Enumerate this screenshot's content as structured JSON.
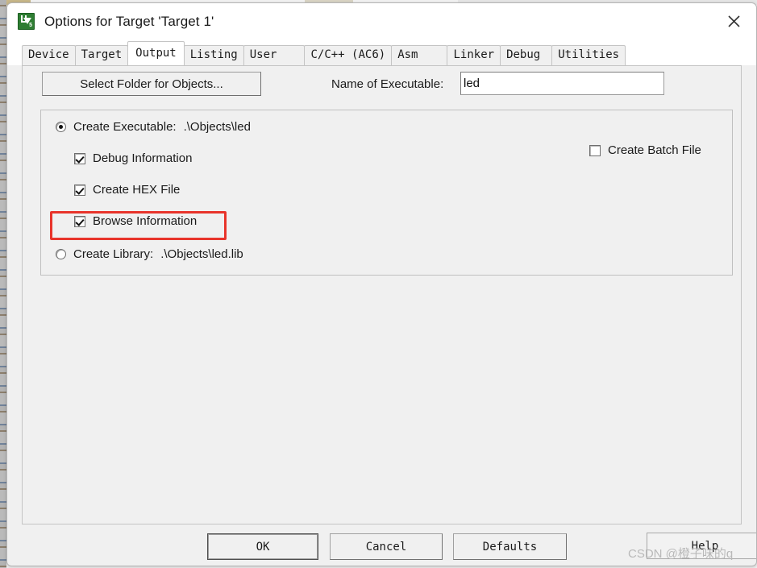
{
  "window": {
    "title": "Options for Target 'Target 1'",
    "icon": "uvision-logo-icon",
    "close_label": "✕"
  },
  "tabs": [
    {
      "label": "Device",
      "selected": false
    },
    {
      "label": "Target",
      "selected": false
    },
    {
      "label": "Output",
      "selected": true
    },
    {
      "label": "Listing",
      "selected": false
    },
    {
      "label": "User",
      "selected": false
    },
    {
      "label": "C/C++ (AC6)",
      "selected": false
    },
    {
      "label": "Asm",
      "selected": false
    },
    {
      "label": "Linker",
      "selected": false
    },
    {
      "label": "Debug",
      "selected": false
    },
    {
      "label": "Utilities",
      "selected": false
    }
  ],
  "output_tab": {
    "select_folder_button": "Select Folder for Objects...",
    "executable_name_label": "Name of Executable:",
    "executable_name_value": "led",
    "executable_name_placeholder": "",
    "create_executable": {
      "label": "Create Executable:",
      "path": ".\\Objects\\led",
      "selected": true
    },
    "debug_information": {
      "label": "Debug Information",
      "checked": true
    },
    "create_hex_file": {
      "label": "Create HEX File",
      "checked": true,
      "highlighted": true
    },
    "browse_information": {
      "label": "Browse Information",
      "checked": true
    },
    "create_library": {
      "label": "Create Library:",
      "path": ".\\Objects\\led.lib",
      "selected": false
    },
    "create_batch_file": {
      "label": "Create Batch File",
      "checked": false
    }
  },
  "footer": {
    "ok": "OK",
    "cancel": "Cancel",
    "defaults": "Defaults",
    "help": "Help"
  },
  "watermark": "CSDN @橙子味的q",
  "colors": {
    "highlight_red": "#e8342b",
    "dialog_face": "#f0f0f0",
    "title_bar": "#ffffff",
    "icon_green": "#2e7d32"
  }
}
